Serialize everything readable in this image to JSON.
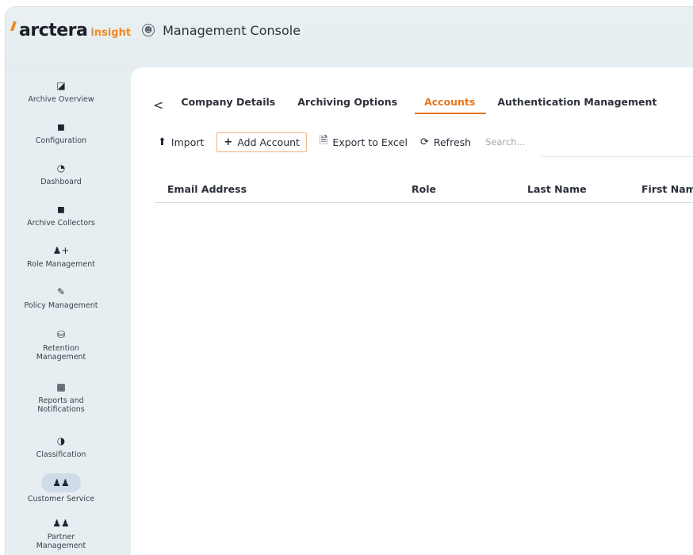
{
  "header": {
    "logo_word": "arctera",
    "logo_sub": "insight",
    "console_icon": "person-circle-icon",
    "console_title": "Management Console"
  },
  "sidebar": {
    "items": [
      {
        "label": "Archive Overview",
        "icon": "binoculars-icon"
      },
      {
        "label": "Configuration",
        "icon": "archive-box-icon"
      },
      {
        "label": "Dashboard",
        "icon": "gauge-icon"
      },
      {
        "label": "Archive Collectors",
        "icon": "archive-box-icon"
      },
      {
        "label": "Role Management",
        "icon": "user-plus-icon"
      },
      {
        "label": "Policy Management",
        "icon": "edit-icon"
      },
      {
        "label": "Retention\nManagement",
        "icon": "database-icon"
      },
      {
        "label": "Reports and\nNotifications",
        "icon": "bar-chart-icon"
      },
      {
        "label": "Classification",
        "icon": "pie-chart-icon"
      },
      {
        "label": "Customer Service",
        "icon": "users-icon",
        "active": true
      },
      {
        "label": "Partner\nManagement",
        "icon": "users-icon"
      }
    ]
  },
  "tabs": {
    "back": "<",
    "items": [
      "Company Details",
      "Archiving Options",
      "Accounts",
      "Authentication Management"
    ],
    "active": "Accounts"
  },
  "toolbar": {
    "import": "Import",
    "add_account": "Add Account",
    "export": "Export to Excel",
    "refresh": "Refresh",
    "search_placeholder": "Search..."
  },
  "table": {
    "columns": [
      "Email Address",
      "Role",
      "Last Name",
      "First Name"
    ],
    "rows": []
  },
  "colors": {
    "accent": "#e8751e",
    "active_nav_bg": "#cfdbe8",
    "chrome_bg": "#e7eef1"
  }
}
